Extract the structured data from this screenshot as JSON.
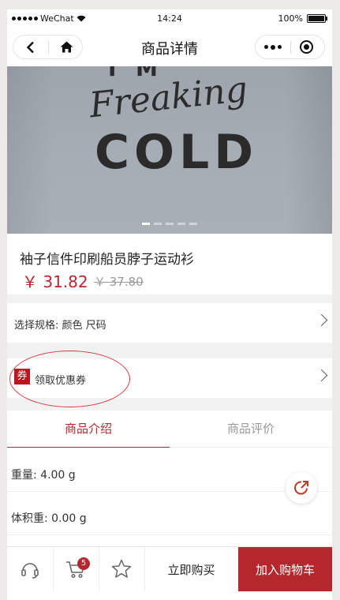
{
  "status_bar": {
    "carrier": "WeChat",
    "time": "14:24",
    "battery": "100%"
  },
  "nav": {
    "title": "商品详情"
  },
  "product_image": {
    "print_lines": [
      "I'M",
      "Freaking",
      "COLD"
    ],
    "slides": 5,
    "active_slide": 1
  },
  "product": {
    "name": "袖子信件印刷船员脖子运动衫",
    "price": "￥ 31.82",
    "original_price": "￥ 37.80"
  },
  "spec_row": {
    "label": "选择规格: 颜色  尺码"
  },
  "coupon_row": {
    "badge": "券",
    "label": "领取优惠券"
  },
  "tabs": [
    {
      "label": "商品介绍",
      "active": true
    },
    {
      "label": "商品评价",
      "active": false
    }
  ],
  "properties": [
    {
      "text": "重量: 4.00 g"
    },
    {
      "text": "体积重: 0.00 g"
    }
  ],
  "bottom_bar": {
    "cart_count": "5",
    "buy_now": "立即购买",
    "add_to_cart": "加入购物车",
    "accent_color": "#b4282d"
  }
}
